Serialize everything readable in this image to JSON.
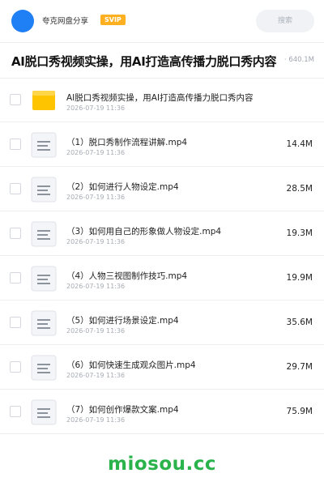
{
  "header": {
    "share_name": "夸克网盘分享",
    "badge": "SVIP",
    "search_placeholder": "搜索",
    "avatar_color": "#1f7ff5",
    "badge_color": "#ffb020"
  },
  "title": {
    "text": "AI脱口秀视频实操，用AI打造高传播力脱口秀内容",
    "total_size": "640.1M"
  },
  "files": [
    {
      "icon": "folder-icon",
      "name": "AI脱口秀视频实操，用AI打造高传播力脱口秀内容",
      "date": "2026-07-19 11:36",
      "size": ""
    },
    {
      "icon": "document-icon",
      "name": "（1）脱口秀制作流程讲解.mp4",
      "date": "2026-07-19 11:36",
      "size": "14.4M"
    },
    {
      "icon": "document-icon",
      "name": "（2）如何进行人物设定.mp4",
      "date": "2026-07-19 11:36",
      "size": "28.5M"
    },
    {
      "icon": "document-icon",
      "name": "（3）如何用自己的形象做人物设定.mp4",
      "date": "2026-07-19 11:36",
      "size": "19.3M"
    },
    {
      "icon": "document-icon",
      "name": "（4）人物三视图制作技巧.mp4",
      "date": "2026-07-19 11:36",
      "size": "19.9M"
    },
    {
      "icon": "document-icon",
      "name": "（5）如何进行场景设定.mp4",
      "date": "2026-07-19 11:36",
      "size": "35.6M"
    },
    {
      "icon": "document-icon",
      "name": "（6）如何快速生成观众图片.mp4",
      "date": "2026-07-19 11:36",
      "size": "29.7M"
    },
    {
      "icon": "document-icon",
      "name": "（7）如何创作爆款文案.mp4",
      "date": "2026-07-19 11:36",
      "size": "75.9M"
    }
  ],
  "watermark": "miosou.cc"
}
